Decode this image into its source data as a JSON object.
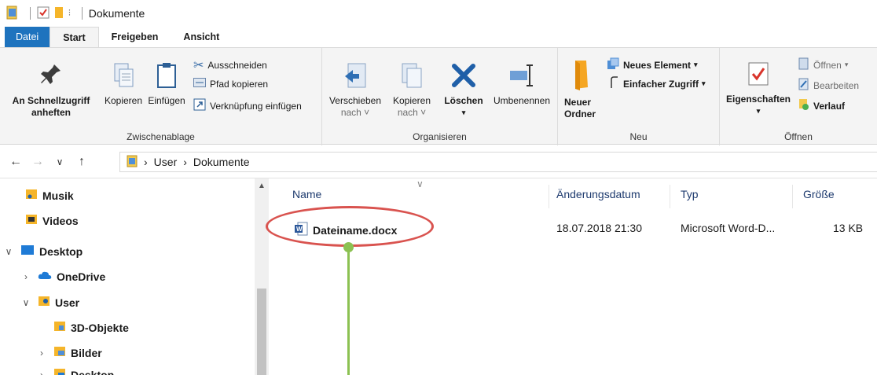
{
  "window": {
    "title": "Dokumente"
  },
  "tabs": [
    {
      "label": "Datei"
    },
    {
      "label": "Start"
    },
    {
      "label": "Freigeben"
    },
    {
      "label": "Ansicht"
    }
  ],
  "ribbon": {
    "clipboard": {
      "label": "Zwischenablage",
      "pin_line1": "An Schnellzugriff",
      "pin_line2": "anheften",
      "copy": "Kopieren",
      "paste": "Einfügen",
      "cut": "Ausschneiden",
      "copy_path": "Pfad kopieren",
      "paste_shortcut": "Verknüpfung einfügen"
    },
    "organize": {
      "label": "Organisieren",
      "move_line1": "Verschieben",
      "move_line2": "nach",
      "copyto_line1": "Kopieren",
      "copyto_line2": "nach",
      "delete": "Löschen",
      "rename": "Umbenennen"
    },
    "new": {
      "label": "Neu",
      "new_folder_line1": "Neuer",
      "new_folder_line2": "Ordner",
      "new_item": "Neues Element",
      "easy_access": "Einfacher Zugriff"
    },
    "open": {
      "label": "Öffnen",
      "properties": "Eigenschaften",
      "open": "Öffnen",
      "edit": "Bearbeiten",
      "history": "Verlauf"
    }
  },
  "address": {
    "crumbs": [
      "User",
      "Dokumente"
    ]
  },
  "nav_pane": {
    "items": [
      {
        "label": "Musik"
      },
      {
        "label": "Videos"
      },
      {
        "label": "Desktop"
      },
      {
        "label": "OneDrive"
      },
      {
        "label": "User"
      },
      {
        "label": "3D-Objekte"
      },
      {
        "label": "Bilder"
      },
      {
        "label": "Desktop"
      }
    ]
  },
  "file_list": {
    "columns": [
      "Name",
      "Änderungsdatum",
      "Typ",
      "Größe"
    ],
    "rows": [
      {
        "name": "Dateiname.docx",
        "date": "18.07.2018 21:30",
        "type": "Microsoft Word-D...",
        "size": "13 KB"
      }
    ]
  },
  "colors": {
    "file_tab": "#1e73be",
    "callout_ellipse": "#d9534f",
    "callout_pin": "#8cc152",
    "delete_x": "#1f5fa8"
  }
}
